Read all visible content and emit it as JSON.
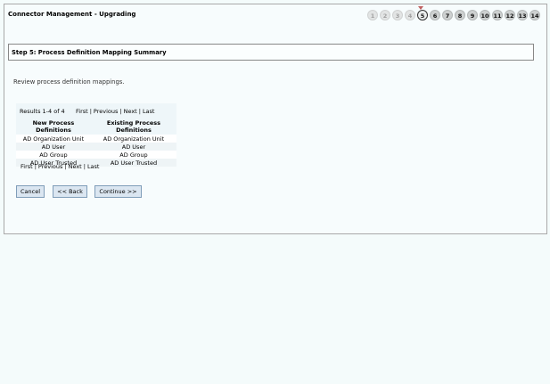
{
  "header": {
    "title": "Connector Management - Upgrading"
  },
  "steps": {
    "items": [
      {
        "label": "1",
        "state": "done"
      },
      {
        "label": "2",
        "state": "done"
      },
      {
        "label": "3",
        "state": "done"
      },
      {
        "label": "4",
        "state": "done"
      },
      {
        "label": "5",
        "state": "current"
      },
      {
        "label": "6",
        "state": "future"
      },
      {
        "label": "7",
        "state": "future"
      },
      {
        "label": "8",
        "state": "future"
      },
      {
        "label": "9",
        "state": "future"
      },
      {
        "label": "10",
        "state": "future"
      },
      {
        "label": "11",
        "state": "future"
      },
      {
        "label": "12",
        "state": "future"
      },
      {
        "label": "13",
        "state": "future"
      },
      {
        "label": "14",
        "state": "future"
      }
    ]
  },
  "step_header": {
    "title": "Step 5: Process Definition Mapping Summary"
  },
  "intro": "Review process definition mappings.",
  "results": {
    "count_label": "Results 1-4 of 4",
    "pager": {
      "first": "First",
      "previous": "Previous",
      "next": "Next",
      "last": "Last",
      "separator": "|"
    }
  },
  "table": {
    "headers": [
      "New Process Definitions",
      "Existing Process Definitions"
    ],
    "rows": [
      [
        "AD Organization Unit",
        "AD Organization Unit"
      ],
      [
        "AD User",
        "AD User"
      ],
      [
        "AD Group",
        "AD Group"
      ],
      [
        "AD User Trusted",
        "AD User Trusted"
      ]
    ]
  },
  "buttons": {
    "cancel": "Cancel",
    "back": "<< Back",
    "continue": "Continue >>"
  }
}
